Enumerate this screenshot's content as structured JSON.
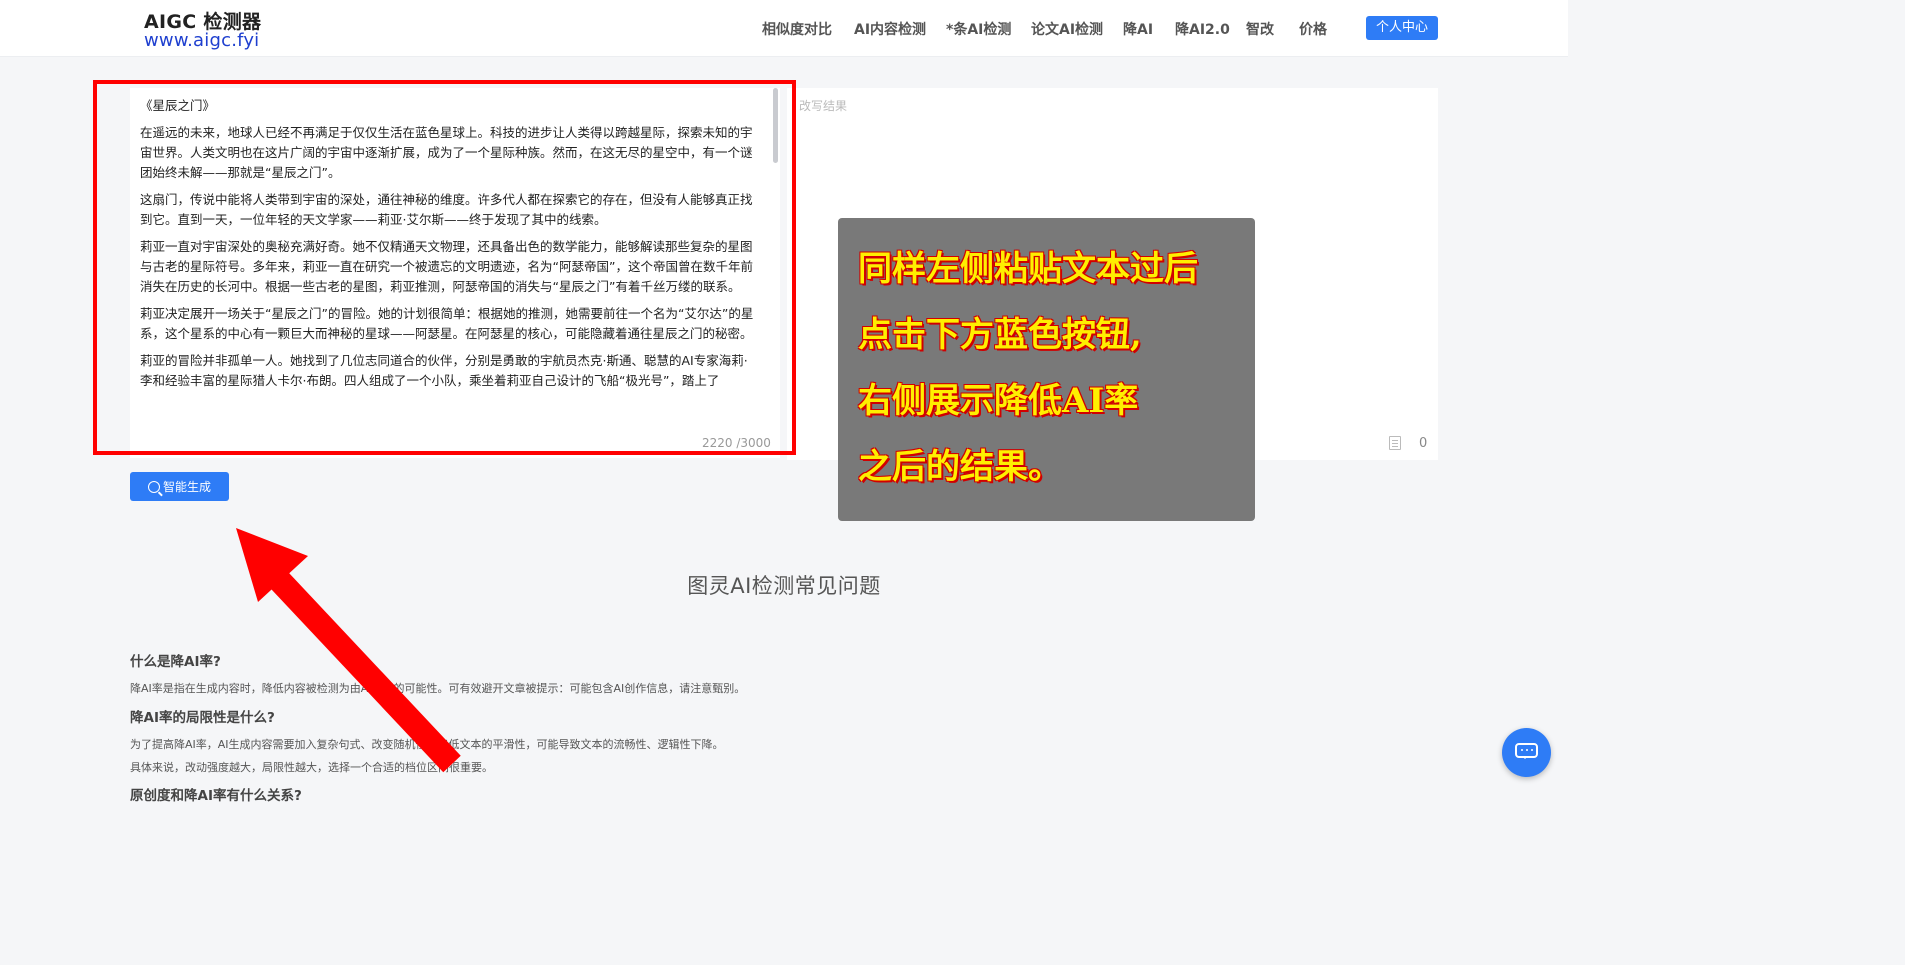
{
  "header": {
    "logo_title": "AIGC 检测器",
    "logo_url": "www.aigc.fyi",
    "nav": [
      "相似度对比",
      "AI内容检测",
      "*条AI检测",
      "论文AI检测",
      "降AI",
      "降AI2.0",
      "智改",
      "价格"
    ],
    "user_center": "个人中心"
  },
  "editor": {
    "paragraphs": [
      "《星辰之门》",
      "在遥远的未来，地球人已经不再满足于仅仅生活在蓝色星球上。科技的进步让人类得以跨越星际，探索未知的宇宙世界。人类文明也在这片广阔的宇宙中逐渐扩展，成为了一个星际种族。然而，在这无尽的星空中，有一个谜团始终未解——那就是“星辰之门”。",
      "这扇门，传说中能将人类带到宇宙的深处，通往神秘的维度。许多代人都在探索它的存在，但没有人能够真正找到它。直到一天，一位年轻的天文学家——莉亚·艾尔斯——终于发现了其中的线索。",
      "莉亚一直对宇宙深处的奥秘充满好奇。她不仅精通天文物理，还具备出色的数学能力，能够解读那些复杂的星图与古老的星际符号。多年来，莉亚一直在研究一个被遗忘的文明遗迹，名为“阿瑟帝国”，这个帝国曾在数千年前消失在历史的长河中。根据一些古老的星图，莉亚推测，阿瑟帝国的消失与“星辰之门”有着千丝万缕的联系。",
      "莉亚决定展开一场关于“星辰之门”的冒险。她的计划很简单：根据她的推测，她需要前往一个名为“艾尔达”的星系，这个星系的中心有一颗巨大而神秘的星球——阿瑟星。在阿瑟星的核心，可能隐藏着通往星辰之门的秘密。",
      "莉亚的冒险并非孤单一人。她找到了几位志同道合的伙伴，分别是勇敢的宇航员杰克·斯通、聪慧的AI专家海莉·李和经验丰富的星际猎人卡尔·布朗。四人组成了一个小队，乘坐着莉亚自己设计的飞船“极光号”，踏上了"
    ],
    "counter": "2220 /3000"
  },
  "result": {
    "placeholder": "改写结果",
    "count": "0"
  },
  "overlay_lines": [
    "同样左侧粘贴文本过后",
    "点击下方蓝色按钮,",
    "右侧展示降低AI率",
    "之后的结果。"
  ],
  "generate_button": "智能生成",
  "faq": {
    "title": "图灵AI检测常见问题",
    "q1": "什么是降AI率?",
    "a1": "降AI率是指在生成内容时，降低内容被检测为由AI生成的可能性。可有效避开文章被提示：可能包含AI创作信息，请注意甄别。",
    "q2": "降AI率的局限性是什么?",
    "a2": "为了提高降AI率，AI生成内容需要加入复杂句式、改变随机性，降低文本的平滑性，可能导致文本的流畅性、逻辑性下降。",
    "a2b": "具体来说，改动强度越大，局限性越大，选择一个合适的档位区间很重要。",
    "q3": "原创度和降AI率有什么关系?"
  },
  "colors": {
    "accent": "#2e7cf6",
    "annotation": "#ff0000",
    "overlay_text": "#ffef00"
  }
}
